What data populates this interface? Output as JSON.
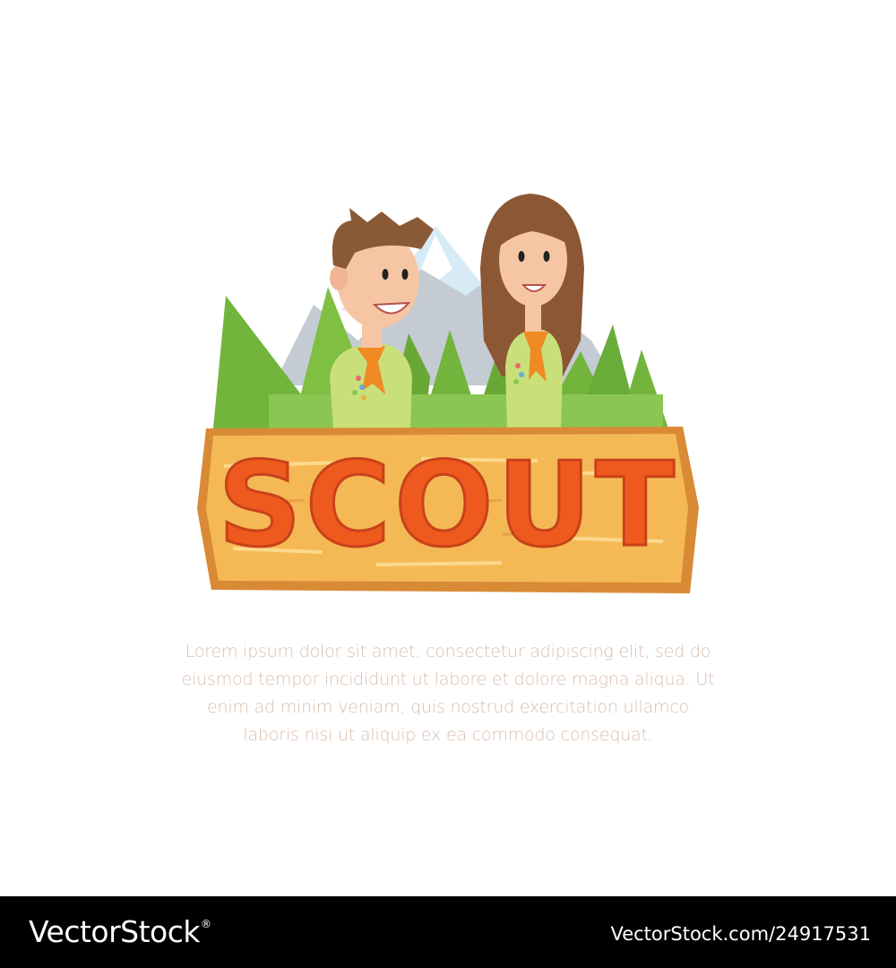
{
  "sign": {
    "title": "SCOUT"
  },
  "body_text": {
    "lines": [
      "Lorem ipsum dolor sit amet, consectetur adipiscing elit, sed do",
      "eiusmod tempor incididunt ut labore et dolore magna aliqua. Ut",
      "enim ad minim veniam, quis nostrud exercitation ullamco",
      "laboris nisi ut aliquip ex ea commodo consequat."
    ]
  },
  "footer": {
    "brand": "VectorStock",
    "brand_mark": "®",
    "image_id": "VectorStock.com/24917531"
  },
  "colors": {
    "background": "#ffffff",
    "footer_background": "#000000",
    "sign_wood": "#f4b955",
    "sign_border": "#d98a35",
    "sign_letters": "#ee5a1e",
    "tree_green": "#72b43c",
    "mountain_grey": "#c4cbd3",
    "uniform_green": "#c9e07a",
    "neckerchief_orange": "#f08a24",
    "body_text": "#d9bfae"
  }
}
